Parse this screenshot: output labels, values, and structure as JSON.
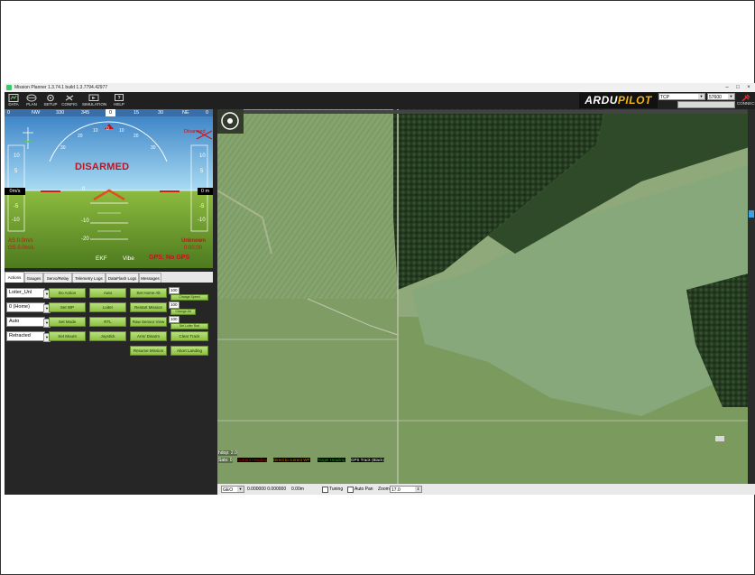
{
  "window": {
    "title": "Mission Planner 1.3.74.1 build 1.3.7794.42977",
    "controls": [
      "–",
      "□",
      "×"
    ]
  },
  "toolbar": {
    "items": [
      {
        "label": "DATA",
        "icon": "data-icon"
      },
      {
        "label": "PLAN",
        "icon": "plan-icon"
      },
      {
        "label": "SETUP",
        "icon": "setup-icon"
      },
      {
        "label": "CONFIG",
        "icon": "config-icon"
      },
      {
        "label": "SIMULATION",
        "icon": "simulation-icon"
      },
      {
        "label": "HELP",
        "icon": "help-icon"
      }
    ],
    "logo_part1": "ARDU",
    "logo_part2": "PILOT",
    "port": "TCP",
    "baud": "57600",
    "connect_label": "CONNECT",
    "colors": {
      "background": "#202020",
      "logo_accent": "#f3b516"
    }
  },
  "hud": {
    "heading_ticks": [
      "0",
      "NW",
      "330",
      "345",
      "0",
      "15",
      "30",
      "NE",
      "0"
    ],
    "heading_current": "0",
    "roll_ticks": [
      "30",
      "20",
      "10",
      "0",
      "10",
      "20",
      "30"
    ],
    "status": "DISARMED",
    "speed_box": "0m/s",
    "alt_box": "0 m",
    "speed_ticks": [
      "10",
      "5",
      "-5",
      "-10"
    ],
    "alt_ticks": [
      "10",
      "5",
      "-5",
      "-10"
    ],
    "pitch_ticks": [
      "-10",
      "-20"
    ],
    "pitch_zero": "0",
    "as_text": "AS 0.0m/s",
    "gs_text": "GS 0.0m/s",
    "mode": "Unknown",
    "time": "0:00:00",
    "ekf": "EKF",
    "vibe": "Vibe",
    "gps": "GPS: No GPS",
    "disarmed_small": "Disarmed",
    "colors": {
      "sky": "#8ccaea",
      "ground": "#79a736",
      "alert": "#c8101a"
    }
  },
  "tabs": [
    "Actions",
    "Gauges",
    "Servo/Relay",
    "Telemetry Logs",
    "DataFlash Logs",
    "Messages"
  ],
  "active_tab": 0,
  "actions": {
    "dropdowns": [
      "Loiter_Unl",
      "0 (Home)",
      "Auto",
      "Retracted"
    ],
    "col1": [
      "Do Action",
      "Set WP",
      "Set Mode",
      "Set Mount"
    ],
    "col2": [
      "Auto",
      "Loiter",
      "RTL",
      "Joystick"
    ],
    "col3": [
      "Set Home Alt",
      "Restart Mission",
      "Raw Sensor View",
      "Arm/ Disarm",
      "Resume Mission"
    ],
    "col4": [
      "Clear Track",
      "Abort Landing"
    ],
    "numbers": [
      "100",
      "100",
      "100"
    ],
    "small_buttons": [
      "Change Speed",
      "Change Alt",
      "Set Loiter Rad"
    ]
  },
  "map": {
    "hdop": "hdop: 2.0",
    "sats": "Sats: 0",
    "legend": [
      {
        "label": "Current Heading",
        "color": "#d01010"
      },
      {
        "label": "Direct to current WP",
        "color": "#d07a10"
      },
      {
        "label": "Target Heading",
        "color": "#2aa02a"
      },
      {
        "label": "GPS Track (Black)",
        "color": "#ffffff"
      }
    ],
    "status_bar": {
      "proj": "GEO",
      "coords": "0.000000 0.000000",
      "alt": "0.00m",
      "tuning": "Tuning",
      "auto_pan": "Auto Pan",
      "zoom_label": "Zoom",
      "zoom_value": "17.0"
    }
  }
}
